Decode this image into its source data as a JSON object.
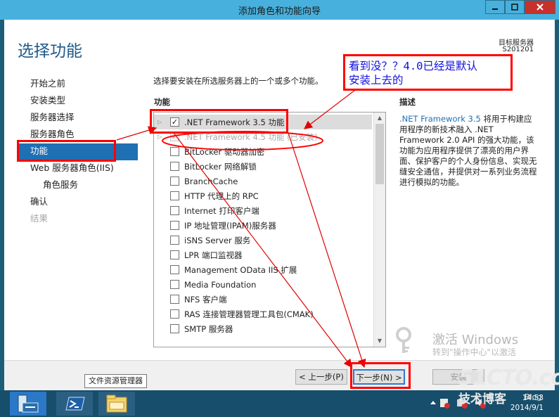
{
  "window": {
    "title": "添加角色和功能向导"
  },
  "header": {
    "page_title": "选择功能",
    "dest_label": "目标服务器",
    "dest_name": "S201201"
  },
  "nav": {
    "items": [
      {
        "label": "开始之前",
        "state": "normal"
      },
      {
        "label": "安装类型",
        "state": "normal"
      },
      {
        "label": "服务器选择",
        "state": "normal"
      },
      {
        "label": "服务器角色",
        "state": "normal"
      },
      {
        "label": "功能",
        "state": "selected"
      },
      {
        "label": "Web 服务器角色(IIS)",
        "state": "normal"
      },
      {
        "label": "角色服务",
        "state": "sub"
      },
      {
        "label": "确认",
        "state": "normal"
      },
      {
        "label": "结果",
        "state": "disabled"
      }
    ]
  },
  "main": {
    "instruction": "选择要安装在所选服务器上的一个或多个功能。",
    "features_label": "功能",
    "features": [
      {
        "label": ".NET Framework 3.5 功能",
        "checked": true,
        "expandable": true,
        "disabled": false,
        "highlight": true
      },
      {
        "label": ".NET Framework 4.5 功能 (已安装)",
        "checked": true,
        "expandable": true,
        "disabled": true,
        "highlight": false
      },
      {
        "label": "BitLocker 驱动器加密",
        "checked": false,
        "expandable": false,
        "disabled": false,
        "highlight": false
      },
      {
        "label": "BitLocker 网络解锁",
        "checked": false,
        "expandable": false,
        "disabled": false,
        "highlight": false
      },
      {
        "label": "BranchCache",
        "checked": false,
        "expandable": false,
        "disabled": false,
        "highlight": false
      },
      {
        "label": "HTTP 代理上的 RPC",
        "checked": false,
        "expandable": false,
        "disabled": false,
        "highlight": false
      },
      {
        "label": "Internet 打印客户端",
        "checked": false,
        "expandable": false,
        "disabled": false,
        "highlight": false
      },
      {
        "label": "IP 地址管理(IPAM)服务器",
        "checked": false,
        "expandable": false,
        "disabled": false,
        "highlight": false
      },
      {
        "label": "iSNS Server 服务",
        "checked": false,
        "expandable": false,
        "disabled": false,
        "highlight": false
      },
      {
        "label": "LPR 端口监视器",
        "checked": false,
        "expandable": false,
        "disabled": false,
        "highlight": false
      },
      {
        "label": "Management OData IIS 扩展",
        "checked": false,
        "expandable": false,
        "disabled": false,
        "highlight": false
      },
      {
        "label": "Media Foundation",
        "checked": false,
        "expandable": false,
        "disabled": false,
        "highlight": false
      },
      {
        "label": "NFS 客户端",
        "checked": false,
        "expandable": false,
        "disabled": false,
        "highlight": false
      },
      {
        "label": "RAS 连接管理器管理工具包(CMAK)",
        "checked": false,
        "expandable": false,
        "disabled": false,
        "highlight": false
      },
      {
        "label": "SMTP 服务器",
        "checked": false,
        "expandable": false,
        "disabled": false,
        "highlight": false
      }
    ],
    "checkmark": "✓"
  },
  "description": {
    "label": "描述",
    "link": ".NET Framework 3.5",
    "text": " 将用于构建应用程序的新技术融入 .NET Framework 2.0 API 的强大功能，该功能为应用程序提供了漂亮的用户界面、保护客户的个人身份信息、实现无缝安全通信，并提供对一系列业务流程进行模拟的功能。"
  },
  "watermark": {
    "title": "激活 Windows",
    "subtitle": "转到\"操作中心\"以激活 Windows。"
  },
  "buttons": {
    "prev": "< 上一步(P)",
    "next": "下一步(N) >",
    "install": "安装"
  },
  "tooltip": {
    "text": "文件资源管理器"
  },
  "taskbar": {
    "time": "14:53",
    "date": "2014/9/1",
    "apps": [
      "server-manager",
      "powershell",
      "file-explorer"
    ]
  },
  "annotation": {
    "callout_line1": "看到没？？4.0已经是默认",
    "callout_line2": "安装上去的"
  },
  "site_watermark": {
    "logo": "51CTO.com",
    "sub": "技术博客",
    "blog": "Blog"
  },
  "colors": {
    "accent": "#1f6fb3",
    "titlebar": "#48b0dc",
    "annotation": "#ff0000",
    "annotation_text": "#1010e0",
    "taskbar": "#174e6b"
  }
}
